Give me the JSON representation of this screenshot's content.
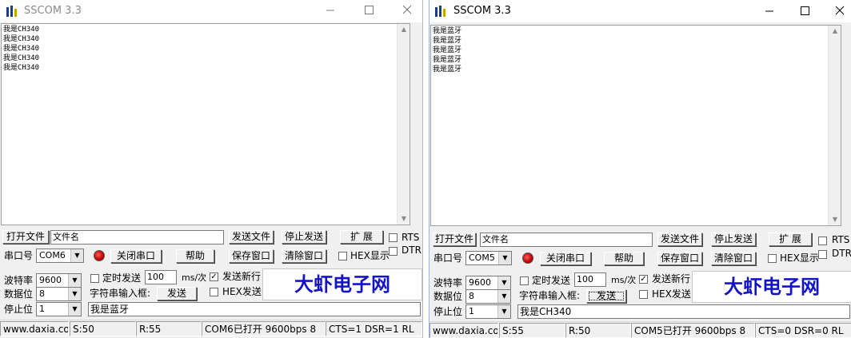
{
  "left": {
    "title": "SSCOM 3.3",
    "rx_lines": [
      "我是CH340",
      "我是CH340",
      "我是CH340",
      "我是CH340",
      "我是CH340"
    ],
    "open_file_label": "打开文件",
    "file_name_value": "文件名",
    "send_file_label": "发送文件",
    "stop_send_label": "停止发送",
    "expand_label": "扩 展",
    "rts_label": "RTS",
    "dtr_label": "DTR",
    "port_label": "串口号",
    "port_value": "COM6",
    "close_port_label": "关闭串口",
    "help_label": "帮助",
    "save_window_label": "保存窗口",
    "clear_window_label": "清除窗口",
    "hex_display_label": "HEX显示",
    "baud_label": "波特率",
    "baud_value": "9600",
    "databits_label": "数据位",
    "databits_value": "8",
    "stopbits_label": "停止位",
    "stopbits_value": "1",
    "timed_send_label": "定时发送",
    "interval_value": "100",
    "interval_unit": "ms/次",
    "send_newline_label": "发送新行",
    "input_label": "字符串输入框:",
    "send_label": "发送",
    "hex_send_label": "HEX发送",
    "logo_text": "大虾电子网",
    "tx_value": "我是蓝牙",
    "status": {
      "site": "www.daxia.com",
      "sent": "S:50",
      "received": "R:55",
      "port_state": "COM6已打开  9600bps  8",
      "lines": "CTS=1 DSR=1 RL"
    }
  },
  "right": {
    "title": "SSCOM 3.3",
    "rx_lines": [
      "我是蓝牙",
      "我是蓝牙",
      "我是蓝牙",
      "我是蓝牙",
      "我是蓝牙"
    ],
    "open_file_label": "打开文件",
    "file_name_value": "文件名",
    "send_file_label": "发送文件",
    "stop_send_label": "停止发送",
    "expand_label": "扩 展",
    "rts_label": "RTS",
    "dtr_label": "DTR",
    "port_label": "串口号",
    "port_value": "COM5",
    "close_port_label": "关闭串口",
    "help_label": "帮助",
    "save_window_label": "保存窗口",
    "clear_window_label": "清除窗口",
    "hex_display_label": "HEX显示",
    "baud_label": "波特率",
    "baud_value": "9600",
    "databits_label": "数据位",
    "databits_value": "8",
    "stopbits_label": "停止位",
    "stopbits_value": "1",
    "timed_send_label": "定时发送",
    "interval_value": "100",
    "interval_unit": "ms/次",
    "send_newline_label": "发送新行",
    "input_label": "字符串输入框:",
    "send_label": "发送",
    "hex_send_label": "HEX发送",
    "logo_text": "大虾电子网",
    "tx_value": "我是CH340",
    "status": {
      "site": "www.daxia.com",
      "sent": "S:55",
      "received": "R:50",
      "port_state": "COM5已打开  9600bps  8",
      "lines": "CTS=0 DSR=0 RL"
    }
  },
  "icons": {
    "app": "sscom-app-icon",
    "minimize": "minimize-icon",
    "maximize": "maximize-icon",
    "close": "close-icon"
  },
  "colors": {
    "logo_blue": "#1212c8",
    "led_red": "#c00000",
    "window_bg": "#f0f0f0"
  }
}
